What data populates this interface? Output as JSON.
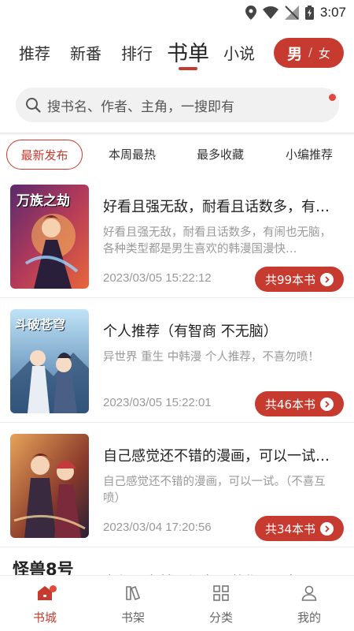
{
  "status_bar": {
    "time": "3:07"
  },
  "top_nav": {
    "tabs": [
      {
        "label": "推荐"
      },
      {
        "label": "新番"
      },
      {
        "label": "排行"
      },
      {
        "label": "书单"
      },
      {
        "label": "小说"
      }
    ],
    "active_index": 3,
    "gender_toggle": {
      "male": "男",
      "separator": "/",
      "female": "女"
    }
  },
  "search": {
    "placeholder": "搜书名、作者、主角，一搜即有"
  },
  "filters": {
    "tabs": [
      {
        "label": "最新发布"
      },
      {
        "label": "本周最热"
      },
      {
        "label": "最多收藏"
      },
      {
        "label": "小编推荐"
      }
    ],
    "active_index": 0
  },
  "booklists": [
    {
      "title": "好看且强无敌，耐看且话数多，有…",
      "description": "好看且强无敌，耐看且话数多，有闹也无脑，各种类型都是男生喜欢的韩漫国漫快…",
      "date": "2023/03/05 15:22:12",
      "count_label": "共99本书",
      "cover_text": "万族之劫"
    },
    {
      "title": "个人推荐（有智商 不无脑）",
      "description": "异世界 重生 中韩漫 个人推荐，不喜勿喷！",
      "date": "2023/03/05 15:22:01",
      "count_label": "共46本书",
      "cover_text": "斗破苍穹"
    },
    {
      "title": "自己感觉还不错的漫画，可以一试…",
      "description": "自己感觉还不错的漫画，可以一试。（不喜互喷）",
      "date": "2023/03/04 17:20:56",
      "count_label": "共34本书",
      "cover_text": ""
    }
  ],
  "partial_item": {
    "cover_text": "怪兽8号",
    "title": "玄幻 · 穿越 · 都市 · 逆袭 · 一书不…"
  },
  "bottom_nav": {
    "items": [
      {
        "label": "书城",
        "icon": "home-icon"
      },
      {
        "label": "书架",
        "icon": "bookshelf-icon"
      },
      {
        "label": "分类",
        "icon": "category-icon"
      },
      {
        "label": "我的",
        "icon": "profile-icon"
      }
    ],
    "active_index": 0
  },
  "colors": {
    "accent": "#c63a2f",
    "notification": "#e04a3c"
  }
}
